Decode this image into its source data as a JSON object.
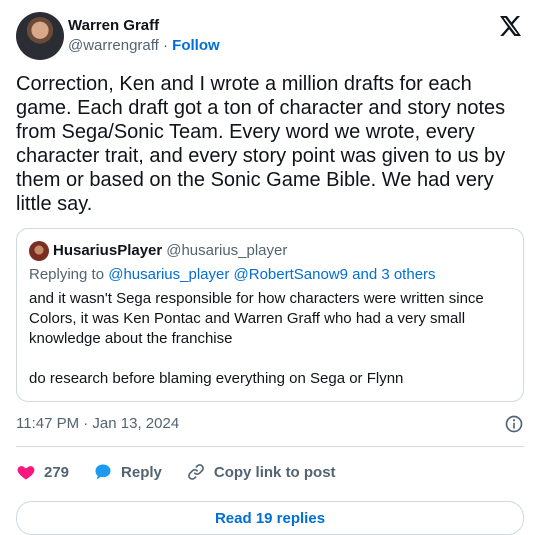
{
  "author": {
    "display_name": "Warren Graff",
    "handle": "@warrengraff",
    "separator": "·",
    "follow_label": "Follow"
  },
  "tweet": {
    "text": "Correction, Ken and I wrote a million drafts for each game. Each draft got a ton of character and story notes from Sega/Sonic Team. Every word we wrote, every character trait, and every story point was given to us by them or based on the Sonic Game Bible. We had very little say."
  },
  "quote": {
    "display_name": "HusariusPlayer",
    "handle": "@husarius_player",
    "replying_prefix": "Replying to",
    "replying_to": "@husarius_player @RobertSanow9",
    "replying_suffix": "and 3 others",
    "text": "and it wasn't Sega responsible for how characters were written since Colors, it was Ken Pontac and Warren Graff who had a very small knowledge about the franchise\n\ndo research before blaming everything on Sega or Flynn"
  },
  "meta": {
    "timestamp": "11:47 PM · Jan 13, 2024"
  },
  "actions": {
    "like_count": "279",
    "reply_label": "Reply",
    "copy_label": "Copy link to post",
    "read_replies_label": "Read 19 replies"
  },
  "colors": {
    "accent": "#006fd6",
    "like": "#f91880",
    "reply_icon": "#1d9bf0",
    "muted": "#536471",
    "border": "#cfd9de"
  }
}
